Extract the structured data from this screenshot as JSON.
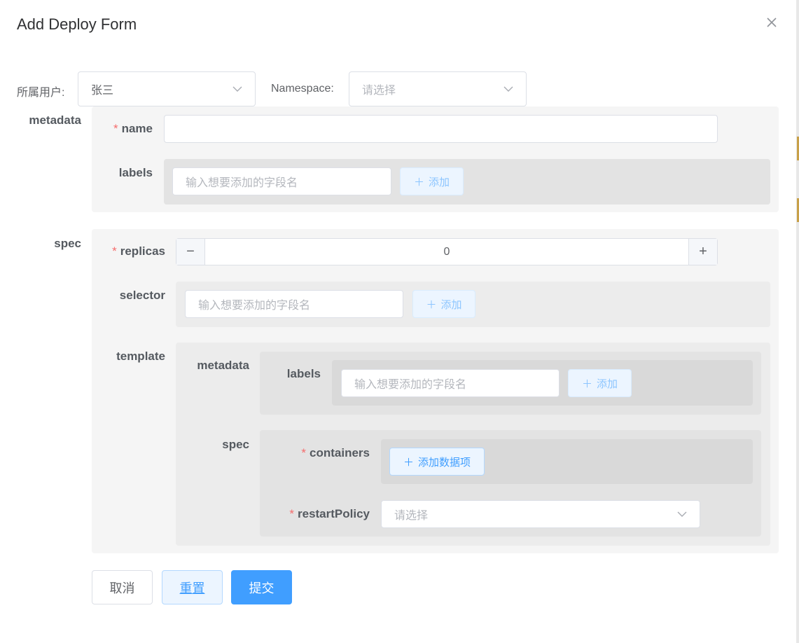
{
  "dialog": {
    "title": "Add Deploy Form"
  },
  "filters": {
    "user_label": "所属用户:",
    "user_value": "张三",
    "namespace_label": "Namespace:",
    "namespace_placeholder": "请选择"
  },
  "metadata": {
    "section_label": "metadata",
    "name_label": "name",
    "name_value": "",
    "labels_label": "labels",
    "labels_placeholder": "输入想要添加的字段名",
    "add_label": "添加"
  },
  "spec": {
    "section_label": "spec",
    "replicas_label": "replicas",
    "replicas_value": "0",
    "selector_label": "selector",
    "selector_placeholder": "输入想要添加的字段名",
    "add_label": "添加",
    "template": {
      "label": "template",
      "metadata_label": "metadata",
      "labels_label": "labels",
      "labels_placeholder": "输入想要添加的字段名",
      "add_label": "添加",
      "spec_label": "spec",
      "containers_label": "containers",
      "add_item_label": "添加数据项",
      "restart_policy_label": "restartPolicy",
      "restart_policy_placeholder": "请选择"
    }
  },
  "actions": {
    "cancel": "取消",
    "reset": "重置",
    "submit": "提交"
  },
  "colors": {
    "primary": "#409eff",
    "required": "#f56c6c"
  }
}
